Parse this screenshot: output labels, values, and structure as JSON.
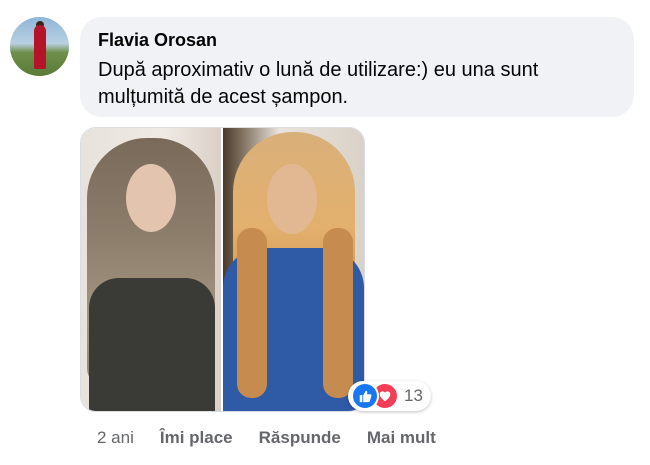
{
  "comment": {
    "author": "Flavia Orosan",
    "text": "După aproximativ o lună de utilizare:) eu una sunt mulțumită de acest șampon.",
    "avatar_icon": "profile-avatar"
  },
  "photo": {
    "description_icon": "before-after-photo",
    "bubble_color": "#f0f2f5"
  },
  "reactions": {
    "icons": [
      "thumbs-up-icon",
      "heart-icon"
    ],
    "like_color": "#1877f2",
    "love_color": "#f33e58",
    "count": "13"
  },
  "actions": {
    "time": "2 ani",
    "like_label": "Îmi place",
    "reply_label": "Răspunde",
    "more_label": "Mai mult",
    "text_color": "#65676b"
  }
}
